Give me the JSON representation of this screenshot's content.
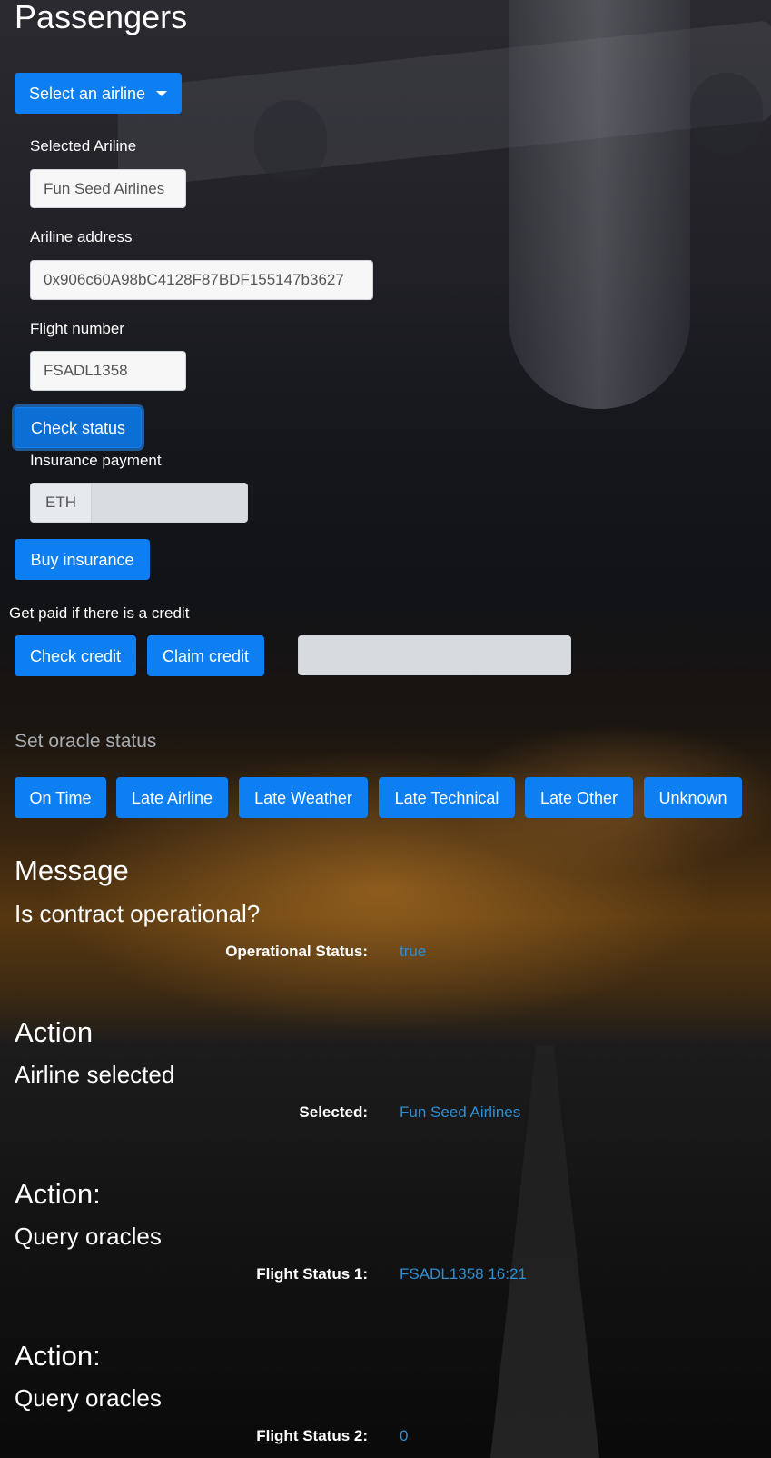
{
  "page": {
    "title": "Passengers"
  },
  "airline_dropdown": {
    "label": "Select an airline"
  },
  "selected_airline": {
    "label": "Selected Ariline",
    "value": "Fun Seed Airlines"
  },
  "airline_address": {
    "label": "Ariline address",
    "value": "0x906c60A98bC4128F87BDF155147b3627"
  },
  "flight_number": {
    "label": "Flight number",
    "value": "FSADL1358"
  },
  "check_status_button": "Check status",
  "insurance": {
    "label": "Insurance payment",
    "currency": "ETH",
    "amount": "",
    "buy_button": "Buy insurance"
  },
  "credit": {
    "label": "Get paid if there is a credit",
    "check_button": "Check credit",
    "claim_button": "Claim credit",
    "value": ""
  },
  "oracle": {
    "label": "Set oracle status",
    "buttons": [
      "On Time",
      "Late Airline",
      "Late Weather",
      "Late Technical",
      "Late Other",
      "Unknown"
    ]
  },
  "display": [
    {
      "title": "Message",
      "description": "Is contract operational?",
      "key": "Operational Status:",
      "value": "true"
    },
    {
      "title": "Action",
      "description": "Airline selected",
      "key": "Selected:",
      "value": "Fun Seed Airlines"
    },
    {
      "title": "Action:",
      "description": "Query oracles",
      "key": "Flight Status 1:",
      "value": "FSADL1358 16:21"
    },
    {
      "title": "Action:",
      "description": "Query oracles",
      "key": "Flight Status 2:",
      "value": "0"
    }
  ],
  "colors": {
    "primary": "#0d7ff2",
    "value_text": "#2d8fd3",
    "muted": "#a8adb3"
  }
}
